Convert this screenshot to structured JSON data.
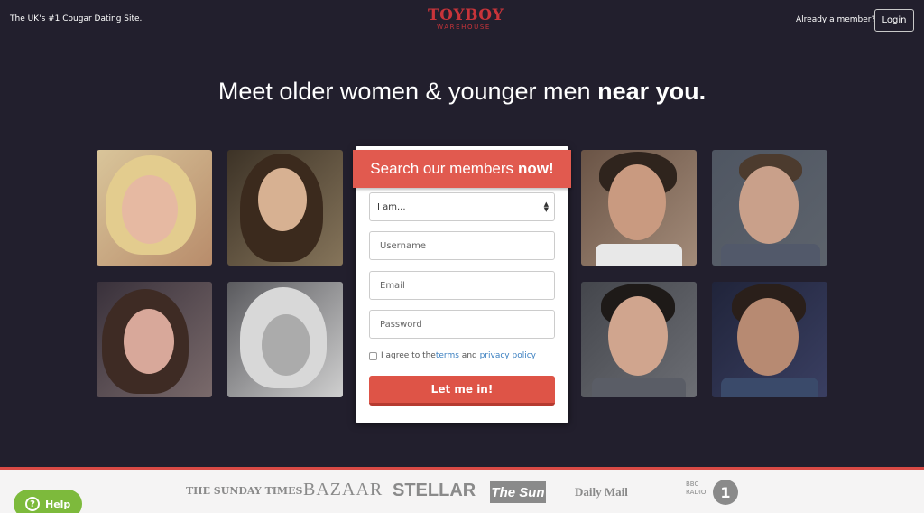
{
  "header": {
    "tagline": "The UK's #1 Cougar Dating Site.",
    "logo_line1": "TOYBOY",
    "logo_line2": "WAREHOUSE",
    "member_question": "Already a member?",
    "login_label": "Login"
  },
  "hero": {
    "headline_prefix": "Meet older women & younger men ",
    "headline_bold": "near you."
  },
  "form": {
    "ribbon_prefix": "Search our members",
    "ribbon_bold": "now!",
    "gender_select_value": "I am...",
    "username_placeholder": "Username",
    "email_placeholder": "Email",
    "password_placeholder": "Password",
    "agree_prefix": "I agree to the ",
    "terms_link": "terms",
    "agree_and": " and ",
    "privacy_link": "privacy policy",
    "submit_label": "Let me in!"
  },
  "press": {
    "sunday_times": "THE SUNDAY TIMES",
    "bazaar": "BAZAAR",
    "stellar": "STELLAR",
    "sun": "The Sun",
    "daily_mail": "Daily Mail",
    "bbc_top": "BBC",
    "bbc_bottom": "RADIO",
    "bbc_number": "1"
  },
  "help": {
    "label": "Help",
    "icon_glyph": "?"
  },
  "colors": {
    "background": "#221f2d",
    "accent": "#e15a4f",
    "help_green": "#7dba3c"
  }
}
